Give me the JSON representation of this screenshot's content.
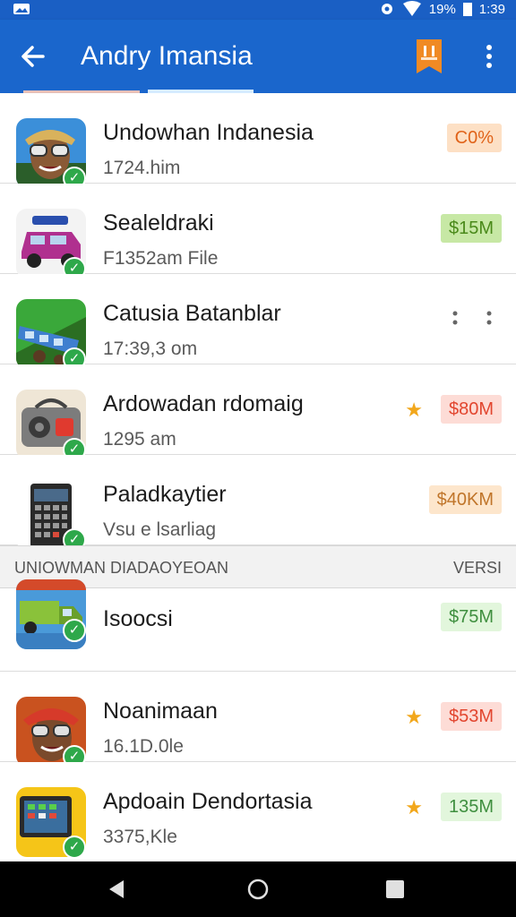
{
  "status_bar": {
    "battery": "19%",
    "time": "1:39"
  },
  "toolbar": {
    "title": "Andry Imansia",
    "back_icon": "arrow-left-icon",
    "bookmark_icon": "bookmark-icon",
    "more_icon": "more-vert-icon"
  },
  "apps": [
    {
      "name": "Undowhan Indanesia",
      "sub": "1724.him",
      "badge": "C0%",
      "badge_style": "orange",
      "star": false,
      "menu": false,
      "icon": "avatar-glasses-icon"
    },
    {
      "name": "Sealeldraki",
      "sub": "F1352am File",
      "badge": "$15M",
      "badge_style": "green",
      "star": false,
      "menu": false,
      "icon": "car-icon"
    },
    {
      "name": "Catusia Batanblar",
      "sub": "17:39,3 om",
      "badge": "",
      "badge_style": "none",
      "star": false,
      "menu": true,
      "icon": "tram-icon"
    },
    {
      "name": "Ardowadan rdomaig",
      "sub": "1295 am",
      "badge": "$80M",
      "badge_style": "red",
      "star": true,
      "menu": false,
      "icon": "radio-icon"
    },
    {
      "name": "Paladkaytier",
      "sub": "Vsu e lsarliag",
      "badge": "$40KM",
      "badge_style": "peach",
      "star": false,
      "menu": false,
      "icon": "phone-icon"
    }
  ],
  "section": {
    "left": "UNIOWMAN DIADAOYEOAN",
    "right": "VERSI"
  },
  "apps2": [
    {
      "name": "Isoocsi",
      "sub": "",
      "badge": "$75M",
      "badge_style": "lightgreen",
      "star": false,
      "icon": "truck-icon"
    },
    {
      "name": "Noanimaan",
      "sub": "16.1D.0le",
      "badge": "$53M",
      "badge_style": "red",
      "star": true,
      "icon": "avatar-glasses-icon"
    },
    {
      "name": "Apdoain Dendortasia",
      "sub": "3375,Kle",
      "badge": "135M",
      "badge_style": "lightgreen",
      "star": true,
      "icon": "tablet-icon"
    }
  ],
  "colors": {
    "toolbar": "#1a66cc",
    "status_bar": "#1a5fc4",
    "check": "#2ea84a",
    "star": "#f2a71b"
  },
  "nav": {
    "back_icon": "nav-back-icon",
    "home_icon": "nav-home-icon",
    "recents_icon": "nav-recents-icon"
  }
}
